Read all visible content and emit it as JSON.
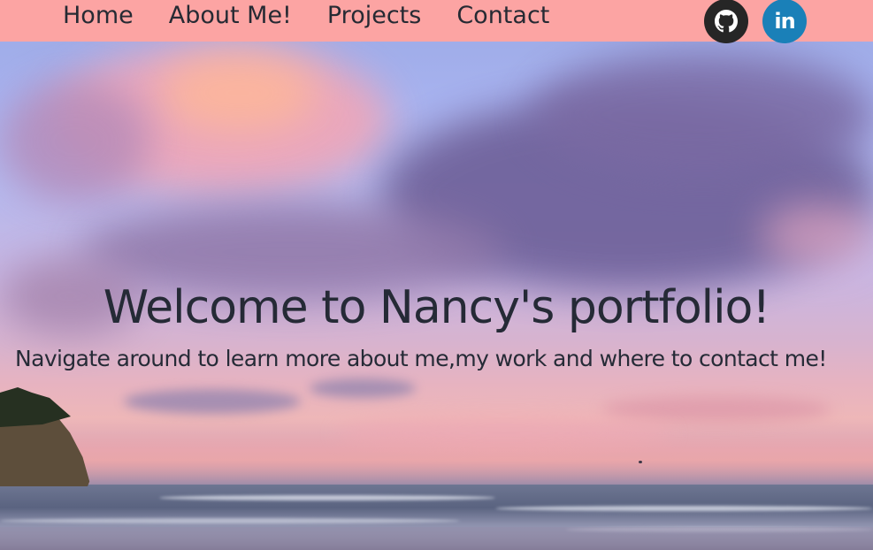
{
  "nav": {
    "links": [
      {
        "label": "Home"
      },
      {
        "label": "About Me!"
      },
      {
        "label": "Projects"
      },
      {
        "label": "Contact"
      }
    ],
    "social": [
      {
        "icon": "github-icon",
        "color": "#262626"
      },
      {
        "icon": "linkedin-icon",
        "label": "in",
        "color": "#1a80b8"
      }
    ],
    "background_color": "#fca4a3"
  },
  "hero": {
    "title": "Welcome to Nancy's portfolio!",
    "subtitle": "Navigate around to learn more about me,my work and where to contact me!"
  }
}
